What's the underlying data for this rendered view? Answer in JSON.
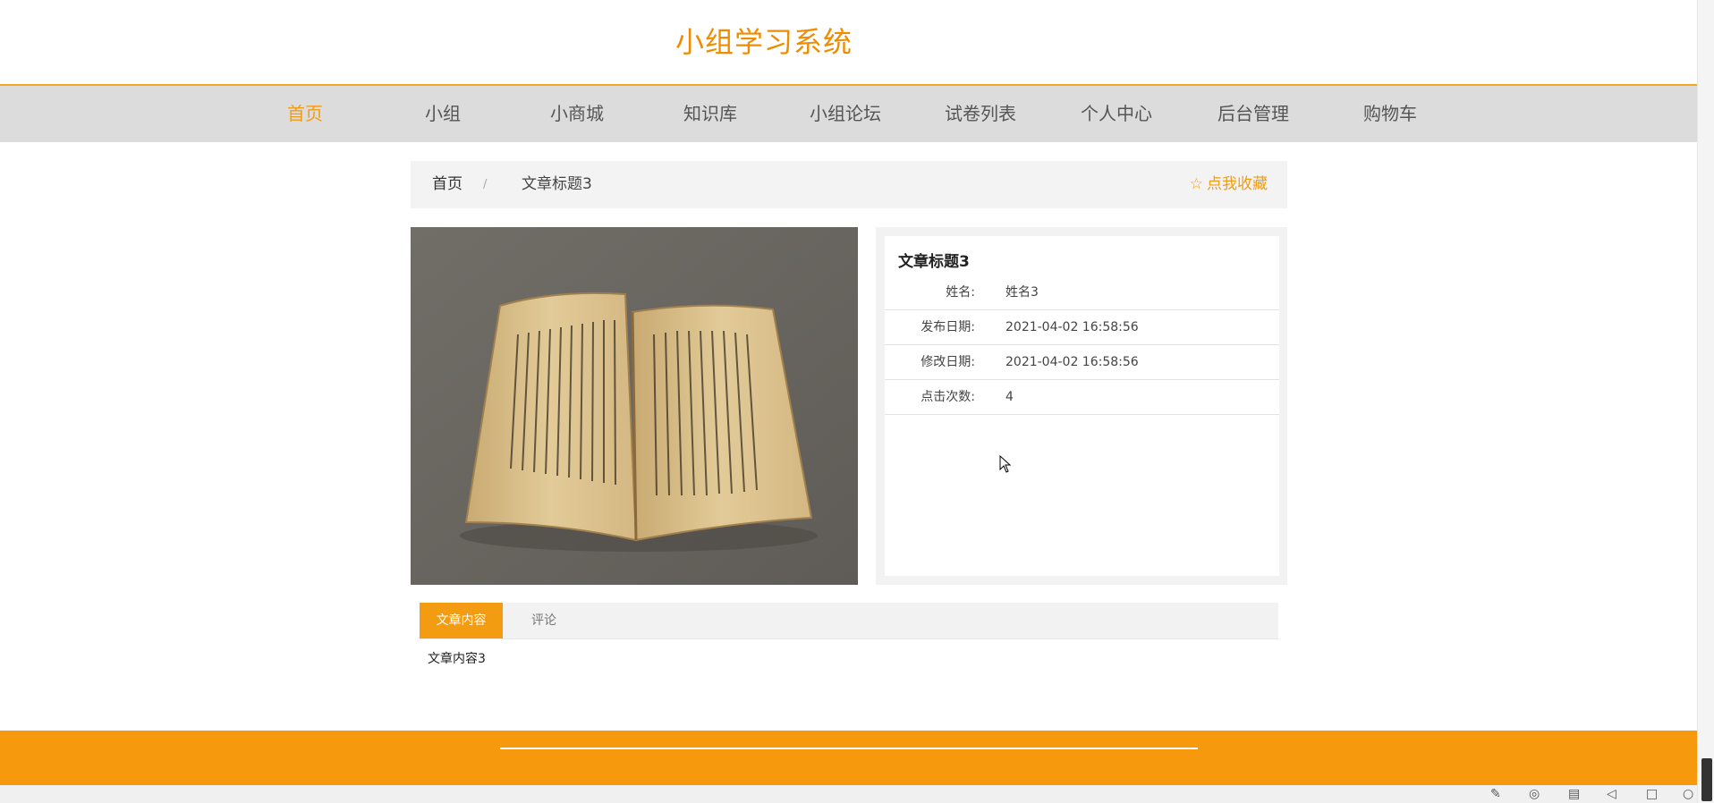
{
  "header": {
    "site_title": "小组学习系统"
  },
  "nav": {
    "items": [
      {
        "label": "首页",
        "active": true
      },
      {
        "label": "小组"
      },
      {
        "label": "小商城"
      },
      {
        "label": "知识库"
      },
      {
        "label": "小组论坛"
      },
      {
        "label": "试卷列表"
      },
      {
        "label": "个人中心"
      },
      {
        "label": "后台管理"
      },
      {
        "label": "购物车"
      }
    ]
  },
  "breadcrumb": {
    "home": "首页",
    "separator": "/",
    "current": "文章标题3"
  },
  "favorite": {
    "icon": "star-outline-icon",
    "label": "点我收藏"
  },
  "article": {
    "image": "open-old-book-photo",
    "title": "文章标题3",
    "fields": [
      {
        "label": "姓名:",
        "value": "姓名3"
      },
      {
        "label": "发布日期:",
        "value": "2021-04-02 16:58:56"
      },
      {
        "label": "修改日期:",
        "value": "2021-04-02 16:58:56"
      },
      {
        "label": "点击次数:",
        "value": "4"
      }
    ]
  },
  "tabs": {
    "content_label": "文章内容",
    "comment_label": "评论"
  },
  "content": {
    "text": "文章内容3"
  },
  "colors": {
    "accent": "#f39c12",
    "footer": "#f7990c",
    "nav_bg": "#dcdcdc"
  },
  "tray": {
    "icons": [
      "pin-icon",
      "network-icon",
      "trash-icon",
      "speaker-icon",
      "window-icon",
      "search-icon"
    ]
  }
}
